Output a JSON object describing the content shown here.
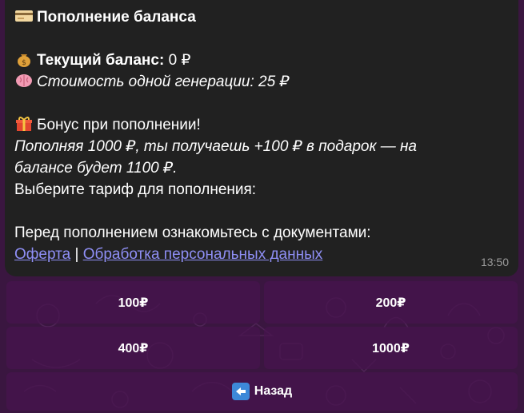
{
  "message": {
    "title": "Пополнение баланса",
    "balance_label": "Текущий баланс:",
    "balance_value": " 0 ₽",
    "generation_cost": "Стоимость одной генерации: 25 ₽",
    "bonus_title": "Бонус при пополнении!",
    "bonus_line1": "Пополняя 1000 ₽, ты получаешь +100 ₽ в подарок — на",
    "bonus_line2": "балансе будет 1100 ₽.",
    "choose_tariff": "Выберите тариф для пополнения:",
    "documents_text": "Перед пополнением ознакомьтесь с документами:",
    "link_offer": "Оферта",
    "link_separator": " | ",
    "link_privacy": "Обработка персональных данных",
    "time": "13:50"
  },
  "keyboard": {
    "btn_100": "100₽",
    "btn_200": "200₽",
    "btn_400": "400₽",
    "btn_1000": "1000₽",
    "back": "Назад"
  },
  "icons": {
    "title": "credit-card-icon",
    "balance": "money-bag-icon",
    "cost": "brain-icon",
    "bonus": "gift-icon",
    "back": "back-arrow-icon"
  },
  "colors": {
    "background": "#3a1640",
    "bubble": "#212121",
    "link": "#8f8ff5",
    "button": "#46144e",
    "back_icon": "#3d88d8"
  }
}
